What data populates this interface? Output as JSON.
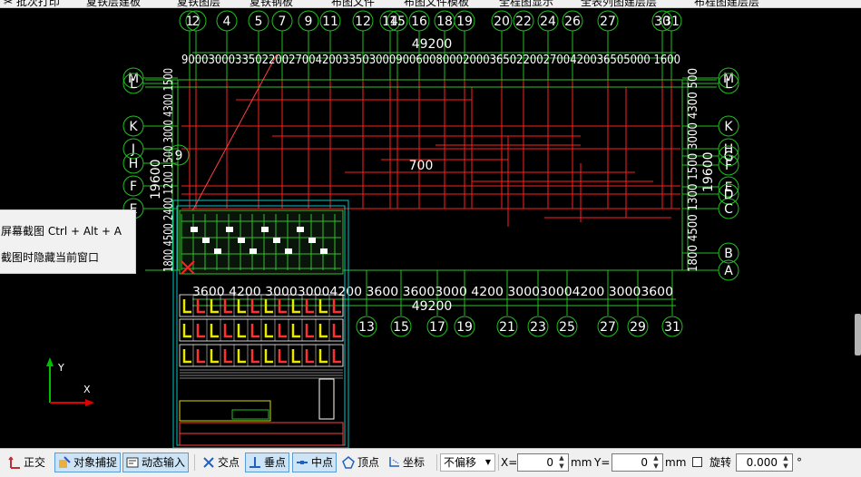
{
  "toolbar_top": {
    "items": [
      "✂ 批次打印",
      "夏铁层建板",
      "夏铁图层",
      "夏铁钢板",
      "布图文件",
      "布图文件模板",
      "全程图显示",
      "全表列图建层层",
      "布程图建层层"
    ]
  },
  "drawing": {
    "colors": {
      "grid": "#ff2020",
      "bubble": "#20c020",
      "dim": "#ffffff",
      "frame": "#00c8c8",
      "ucs_x": "#e00000",
      "ucs_y": "#00c000"
    },
    "top_axes": [
      "1",
      "2",
      "4",
      "5",
      "7",
      "9",
      "11",
      "12",
      "14",
      "15",
      "16",
      "18",
      "19",
      "20",
      "22",
      "24",
      "26",
      "27",
      "30",
      "31"
    ],
    "bottom_axes": [
      "13",
      "15",
      "17",
      "19",
      "21",
      "23",
      "25",
      "27",
      "29",
      "31"
    ],
    "left_axes": [
      "M",
      "L",
      "K",
      "J",
      "H",
      "F",
      "E",
      "C"
    ],
    "right_axes": [
      "M",
      "L",
      "K",
      "H",
      "G",
      "F",
      "E",
      "D",
      "C",
      "B",
      "A"
    ],
    "top_total": "49200",
    "top_dims_text": "9000300033502200270042003350300090060080002000365022002700420036505000 1600",
    "bottom_total": "49200",
    "bottom_dims_text": "3600 4200 300030004200 3600 36003000 4200 300030004200 30003600",
    "left_dims_text": "1800 4500 2400 1200 1500 3000 4300 1500",
    "left_total": "19600",
    "right_total": "19600",
    "right_dims_text": "1800 4500 1300 1500 3000 4300 500",
    "center_label": "700",
    "axis_9_left": "9",
    "ucs_x_label": "X",
    "ucs_y_label": "Y"
  },
  "tooltip": {
    "line1": "屏幕截图 Ctrl + Alt + A",
    "line2": "截图时隐藏当前窗口"
  },
  "statusbar": {
    "ortho": "正交",
    "osnap": "对象捕捉",
    "dyninput": "动态输入",
    "intersection": "交点",
    "perpendicular": "垂点",
    "midpoint": "中点",
    "vertex": "顶点",
    "coordinate": "坐标",
    "offset_select": "不偏移",
    "x_label": "X=",
    "x_value": "0",
    "x_unit": "mm",
    "y_label": "Y=",
    "y_value": "0",
    "y_unit": "mm",
    "rotate_label": "旋转",
    "rotate_value": "0.000",
    "degree": "°"
  }
}
